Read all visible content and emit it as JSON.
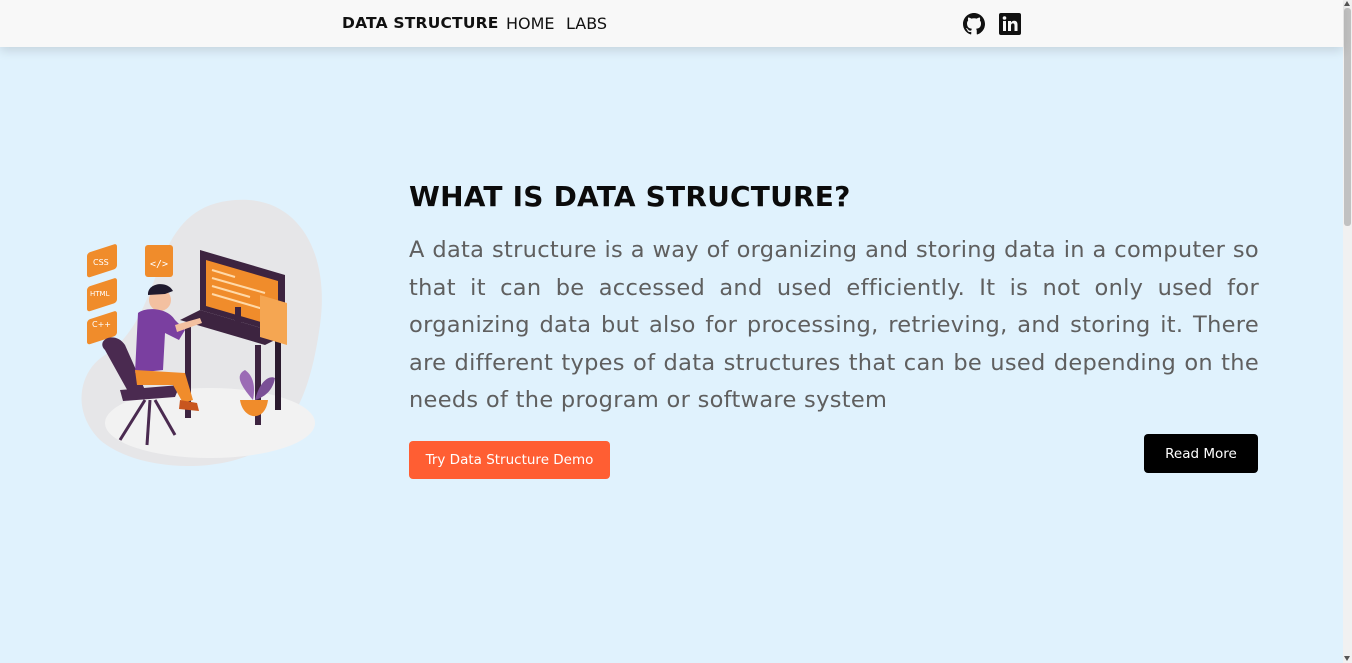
{
  "navbar": {
    "brand": "DATA STRUCTURE",
    "links": [
      {
        "label": "HOME"
      },
      {
        "label": "LABS"
      }
    ],
    "social_icons": [
      "github-icon",
      "linkedin-icon"
    ]
  },
  "hero": {
    "illustration_labels": [
      "CSS",
      "HTML",
      "C++",
      "</>"
    ],
    "title": "WHAT IS DATA STRUCTURE?",
    "description": "A data structure is a way of organizing and storing data in a computer so that it can be accessed and used efficiently. It is not only used for organizing data but also for processing, retrieving, and storing it. There are different types of data structures that can be used depending on the needs of the program or software system",
    "primary_button": "Try Data Structure Demo",
    "secondary_button": "Read More"
  },
  "colors": {
    "page_background": "#e0f2fd",
    "navbar_background": "#f8f8f8",
    "accent_orange": "#ff5e33",
    "read_more_background": "#000000",
    "text_muted": "#5f5f5f"
  }
}
